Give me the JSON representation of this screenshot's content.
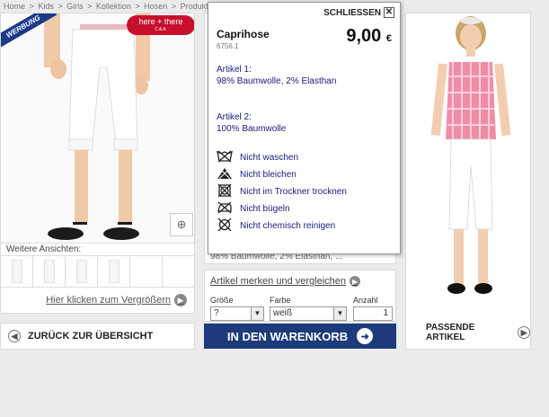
{
  "breadcrumb": [
    "Home",
    ">",
    "Kids",
    ">",
    "Girls",
    ">",
    "Kollektion",
    ">",
    "Hosen",
    ">",
    "Produktinformatio"
  ],
  "left": {
    "werbung": "WERBUNG",
    "brand": "here + there",
    "brand_sub": "C&A",
    "weitere_label": "Weitere Ansichten:",
    "enlarge_link": "Hier klicken zum Vergrößern",
    "thumbnails": 6
  },
  "back_button": "ZURÜCK ZUR ÜBERSICHT",
  "mid": {
    "variant_line": "98% Baumwolle, 2% Elasthan, ...",
    "merken_link": "Artikel merken und vergleichen",
    "size_label": "Größe",
    "size_value": "?",
    "color_label": "Farbe",
    "color_value": "weiß",
    "qty_label": "Anzahl",
    "qty_value": "1",
    "cart_button": "IN DEN WARENKORB"
  },
  "right": {
    "passende": "PASSENDE ARTIKEL"
  },
  "popup": {
    "close_label": "SCHLIESSEN",
    "title": "Caprihose",
    "sku": "6756.1",
    "price": "9,00",
    "currency": "€",
    "art1_label": "Artikel 1:",
    "art1_value": "98% Baumwolle, 2% Elasthan",
    "art2_label": "Artikel 2:",
    "art2_value": "100% Baumwolle",
    "care": [
      {
        "icon": "no-wash-icon",
        "label": "Nicht waschen"
      },
      {
        "icon": "no-bleach-icon",
        "label": "Nicht bleichen"
      },
      {
        "icon": "no-tumble-dry-icon",
        "label": "Nicht im Trockner trocknen"
      },
      {
        "icon": "no-iron-icon",
        "label": "Nicht bügeln"
      },
      {
        "icon": "no-dry-clean-icon",
        "label": "Nicht chemisch reinigen"
      }
    ]
  },
  "colors": {
    "cart_blue": "#1d3a7a",
    "brand_red": "#c8102e",
    "popup_text": "#1a1a7a"
  }
}
